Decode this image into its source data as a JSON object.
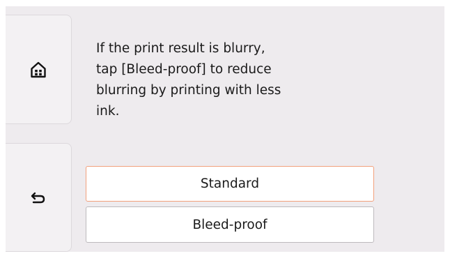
{
  "side_nav": {
    "home_icon": "home-icon",
    "back_icon": "back-arrow-icon"
  },
  "message": {
    "text": "If the print result is blurry,\ntap [Bleed-proof] to reduce\nblurring by printing with less\nink."
  },
  "options": [
    {
      "label": "Standard",
      "selected": true
    },
    {
      "label": "Bleed-proof",
      "selected": false
    }
  ],
  "colors": {
    "screen_bg": "#eeebee",
    "selected_border": "#f2a07c",
    "button_border": "#bdbabd"
  }
}
